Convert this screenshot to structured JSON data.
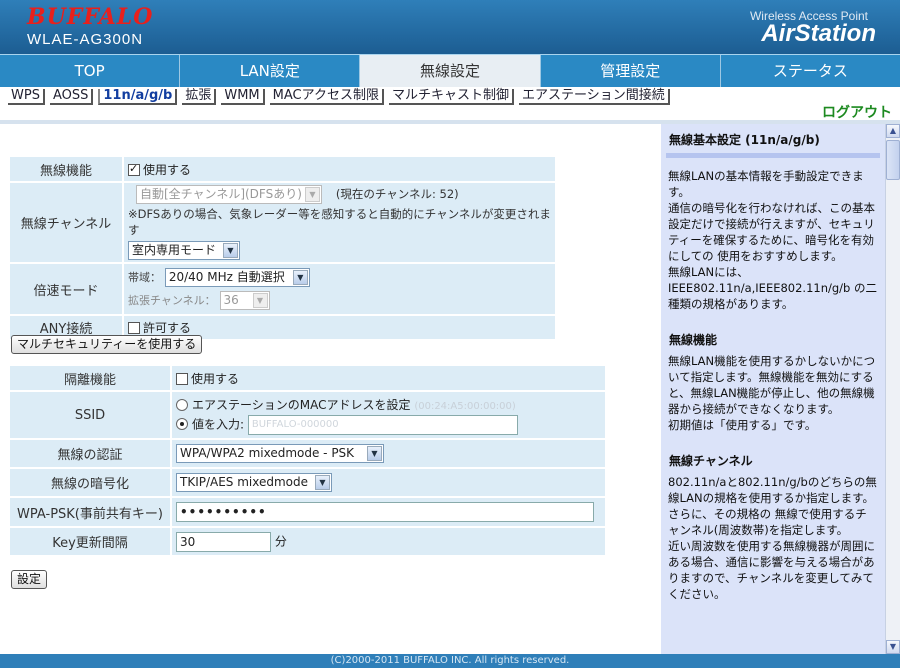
{
  "header": {
    "logo": "BUFFALO",
    "model": "WLAE-AG300N",
    "subtitle": "Wireless Access Point",
    "product": "AirStation"
  },
  "nav": {
    "tabs": [
      "TOP",
      "LAN設定",
      "無線設定",
      "管理設定",
      "ステータス"
    ],
    "active": 2
  },
  "subnav": {
    "tabs": [
      "WPS",
      "AOSS",
      "11n/a/g/b",
      "拡張",
      "WMM",
      "MACアクセス制限",
      "マルチキャスト制御",
      "エアステーション間接続"
    ],
    "active": 2
  },
  "logout": "ログアウト",
  "basic": {
    "wireless_function": {
      "label": "無線機能",
      "checkbox_label": "使用する",
      "checked": true
    },
    "channel": {
      "label": "無線チャンネル",
      "select_value": "自動[全チャンネル](DFSあり)",
      "current": "(現在のチャンネル: 52)",
      "note": "※DFSありの場合、気象レーダー等を感知すると自動的にチャンネルが変更されます",
      "mode_value": "室内専用モード"
    },
    "speed": {
      "label": "倍速モード",
      "band_label": "帯域：",
      "band_value": "20/40 MHz 自動選択",
      "ext_label": "拡張チャンネル：",
      "ext_value": "36"
    },
    "any": {
      "label": "ANY接続",
      "checkbox_label": "許可する",
      "checked": false
    }
  },
  "multisecurity_button": "マルチセキュリティーを使用する",
  "security": {
    "isolation": {
      "label": "隔離機能",
      "checkbox_label": "使用する",
      "checked": false
    },
    "ssid": {
      "label": "SSID",
      "option1": "エアステーションのMACアドレスを設定",
      "option1_value": "(00:24:A5:00:00:00)",
      "option2": "値を入力:",
      "value": "BUFFALO-000000"
    },
    "auth": {
      "label": "無線の認証",
      "value": "WPA/WPA2 mixedmode - PSK"
    },
    "encryption": {
      "label": "無線の暗号化",
      "value": "TKIP/AES mixedmode"
    },
    "psk": {
      "label": "WPA-PSK(事前共有キー)",
      "value": "••••••••••"
    },
    "rekey": {
      "label": "Key更新間隔",
      "value": "30",
      "unit": "分"
    }
  },
  "submit_button": "設定",
  "help": {
    "title": "無線基本設定 (11n/a/g/b)",
    "intro": [
      "無線LANの基本情報を手動設定できます。",
      "通信の暗号化を行わなければ、この基本設定だけで接続が行えますが、セキュリティーを確保するために、暗号化を有効にしての 使用をおすすめします。",
      "無線LANには、IEEE802.11n/a,IEEE802.11n/g/b の二種類の規格があります。"
    ],
    "sec1_title": "無線機能",
    "sec1": [
      "無線LAN機能を使用するかしないかについて指定します。無線機能を無効にすると、無線LAN機能が停止し、他の無線機器から接続ができなくなります。",
      "初期値は「使用する」です。"
    ],
    "sec2_title": "無線チャンネル",
    "sec2": [
      "802.11n/aと802.11n/g/bのどちらの無線LANの規格を使用するか指定します。",
      "さらに、その規格の 無線で使用するチャンネル(周波数帯)を指定します。",
      "近い周波数を使用する無線機器が周囲にある場合、通信に影響を与える場合がありますので、チャンネルを変更してみてください。"
    ]
  },
  "footer": "(C)2000-2011 BUFFALO INC. All rights reserved."
}
